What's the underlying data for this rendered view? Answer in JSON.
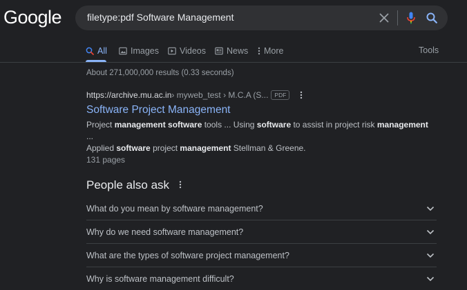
{
  "header": {
    "logo_text": "Google",
    "search": {
      "query": "filetype:pdf Software Management"
    }
  },
  "tabs": [
    {
      "label": "All",
      "active": true,
      "icon": "search-icon"
    },
    {
      "label": "Images",
      "icon": "image-icon"
    },
    {
      "label": "Videos",
      "icon": "video-icon"
    },
    {
      "label": "News",
      "icon": "news-icon"
    },
    {
      "label": "More",
      "icon": "more-vert-icon"
    }
  ],
  "tools_label": "Tools",
  "result_stats": "About 271,000,000 results (0.33 seconds)",
  "result": {
    "cite_domain": "https://archive.mu.ac.in",
    "cite_path": " › myweb_test › M.C.A (S...",
    "badge": "PDF",
    "title": "Software Project Management",
    "snippet_line1": [
      {
        "t": "Project ",
        "b": false
      },
      {
        "t": "management software",
        "b": true
      },
      {
        "t": " tools ... Using ",
        "b": false
      },
      {
        "t": "software",
        "b": true
      },
      {
        "t": " to assist in project risk ",
        "b": false
      },
      {
        "t": "management",
        "b": true
      },
      {
        "t": " ...",
        "b": false
      }
    ],
    "snippet_line2": [
      {
        "t": "Applied ",
        "b": false
      },
      {
        "t": "software",
        "b": true
      },
      {
        "t": " project ",
        "b": false
      },
      {
        "t": "management",
        "b": true
      },
      {
        "t": " Stellman & Greene.",
        "b": false
      }
    ],
    "pages": "131 pages"
  },
  "people_also_ask": {
    "title": "People also ask",
    "questions": [
      "What do you mean by software management?",
      "Why do we need software management?",
      "What are the types of software project management?",
      "Why is software management difficult?"
    ]
  },
  "colors": {
    "background": "#202124",
    "link": "#8ab4f8",
    "mic_blue": "#4285f4",
    "mic_red": "#ea4335",
    "mic_yellow": "#fbbc05",
    "mic_green": "#34a853"
  }
}
